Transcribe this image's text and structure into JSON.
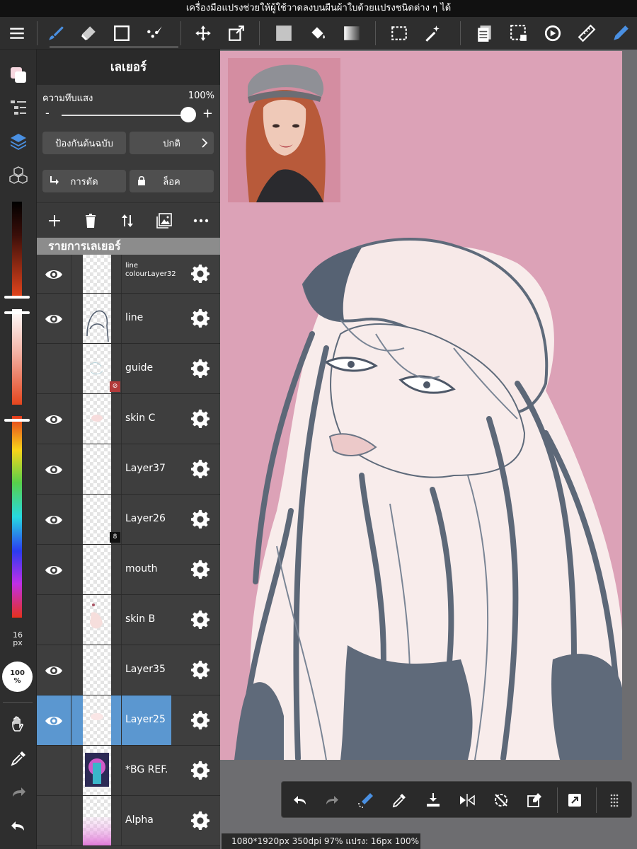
{
  "hint_banner": "เครื่องมือแปรงช่วยให้ผู้ใช้วาดลงบนผืนผ้าใบด้วยแปรงชนิดต่าง ๆ ได้",
  "colors": {
    "accent": "#5b97d0",
    "canvas_bg": "#dca2b7",
    "toolbar_bg": "#2e2e2e",
    "panel_bg": "#3e3e3e",
    "pen_active": "#4a90e2"
  },
  "top_toolbar": {
    "tools": [
      "menu-icon",
      "brush-icon",
      "eraser-icon",
      "rectangle-icon",
      "line-pen-icon",
      "move-icon",
      "transform-icon",
      "fill-color-icon",
      "bucket-icon",
      "gradient-icon",
      "select-icon",
      "magic-wand-icon",
      "copy-layers-icon",
      "select-area-icon",
      "rotate-icon",
      "ruler-icon",
      "pen-icon"
    ]
  },
  "left_bar": {
    "brush_size_value": "16",
    "brush_size_unit": "px",
    "brush_opacity_value": "100",
    "brush_opacity_unit": "%"
  },
  "layer_panel": {
    "title": "เลเยอร์",
    "opacity_label": "ความทึบแสง",
    "opacity_value": "100%",
    "opacity_fraction": 1.0,
    "opacity_minus": "-",
    "opacity_plus": "+",
    "protect_alpha_label": "ป้องกันต้นฉบับ",
    "blend_mode_label": "ปกติ",
    "clipping_label": "การตัด",
    "lock_label": "ล็อค",
    "list_header": "รายการเลเยอร์",
    "layers": [
      {
        "name": "line colourLayer32",
        "visible": true,
        "selected": false
      },
      {
        "name": "line",
        "visible": true,
        "selected": false
      },
      {
        "name": "guide",
        "visible": false,
        "selected": false,
        "badge": "⊘"
      },
      {
        "name": "skin C",
        "visible": true,
        "selected": false
      },
      {
        "name": "Layer37",
        "visible": true,
        "selected": false
      },
      {
        "name": "Layer26",
        "visible": true,
        "selected": false,
        "badge": "8"
      },
      {
        "name": "mouth",
        "visible": true,
        "selected": false
      },
      {
        "name": "skin B",
        "visible": false,
        "selected": false
      },
      {
        "name": "Layer35",
        "visible": true,
        "selected": false
      },
      {
        "name": "Layer25",
        "visible": true,
        "selected": true
      },
      {
        "name": "*BG REF.",
        "visible": false,
        "selected": false
      },
      {
        "name": "Alpha",
        "visible": false,
        "selected": false
      }
    ]
  },
  "status_bar": {
    "text": "1080*1920px 350dpi 97% แปรง: 16px 100%"
  }
}
